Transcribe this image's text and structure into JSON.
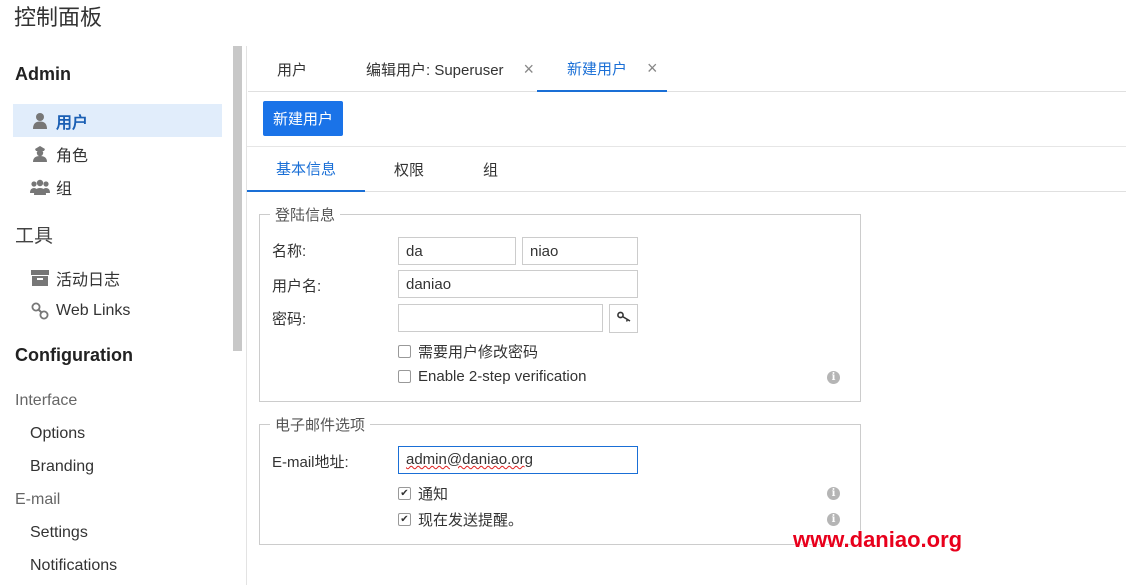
{
  "page": {
    "title": "控制面板"
  },
  "sidebar": {
    "admin_title": "Admin",
    "admin_items": [
      {
        "label": "用户",
        "icon": "user-icon"
      },
      {
        "label": "角色",
        "icon": "role-icon"
      },
      {
        "label": "组",
        "icon": "group-icon"
      }
    ],
    "tools_title": "工具",
    "tools_items": [
      {
        "label": "活动日志",
        "icon": "archive-icon"
      },
      {
        "label": "Web Links",
        "icon": "link-icon"
      }
    ],
    "config_title": "Configuration",
    "interface_group": "Interface",
    "interface_items": [
      "Options",
      "Branding"
    ],
    "email_group": "E-mail",
    "email_items": [
      "Settings",
      "Notifications"
    ]
  },
  "tabs": {
    "users": "用户",
    "edit_user": "编辑用户: Superuser",
    "new_user": "新建用户",
    "close_glyph": "×"
  },
  "toolbar": {
    "new_user_button": "新建用户"
  },
  "subtabs": {
    "basic": "基本信息",
    "permissions": "权限",
    "groups": "组"
  },
  "login_info": {
    "legend": "登陆信息",
    "name_label": "名称:",
    "first_name": "da",
    "last_name": "niao",
    "username_label": "用户名:",
    "username": "daniao",
    "password_label": "密码:",
    "password": "",
    "require_change_label": "需要用户修改密码",
    "require_change_checked": false,
    "two_step_label": "Enable 2-step verification",
    "two_step_checked": false
  },
  "email_options": {
    "legend": "电子邮件选项",
    "email_label": "E-mail地址:",
    "email": "admin@daniao.org",
    "notify_label": "通知",
    "notify_checked": true,
    "send_reminder_label": "现在发送提醒。",
    "send_reminder_checked": true
  },
  "watermark": "www.daniao.org",
  "colors": {
    "accent": "#1a73e8",
    "active_bg": "#e1edfb",
    "watermark": "#e8001c"
  }
}
